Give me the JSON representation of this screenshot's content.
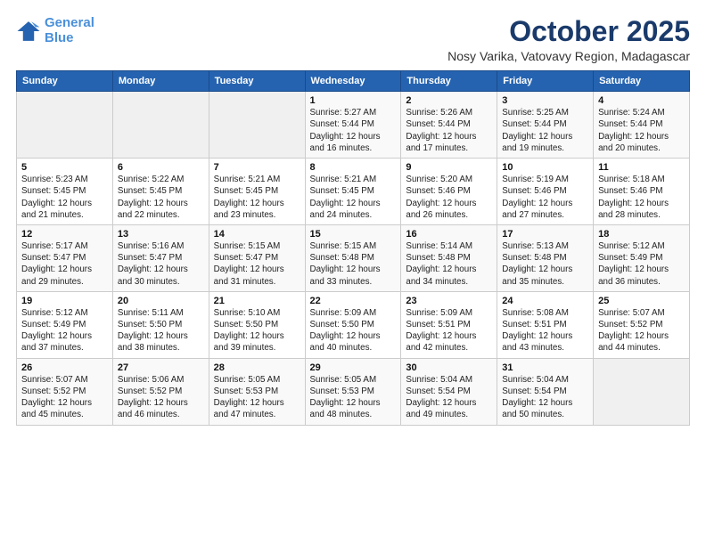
{
  "logo": {
    "line1": "General",
    "line2": "Blue"
  },
  "title": "October 2025",
  "location": "Nosy Varika, Vatovavy Region, Madagascar",
  "headers": [
    "Sunday",
    "Monday",
    "Tuesday",
    "Wednesday",
    "Thursday",
    "Friday",
    "Saturday"
  ],
  "weeks": [
    [
      {
        "day": "",
        "info": ""
      },
      {
        "day": "",
        "info": ""
      },
      {
        "day": "",
        "info": ""
      },
      {
        "day": "1",
        "info": "Sunrise: 5:27 AM\nSunset: 5:44 PM\nDaylight: 12 hours and 16 minutes."
      },
      {
        "day": "2",
        "info": "Sunrise: 5:26 AM\nSunset: 5:44 PM\nDaylight: 12 hours and 17 minutes."
      },
      {
        "day": "3",
        "info": "Sunrise: 5:25 AM\nSunset: 5:44 PM\nDaylight: 12 hours and 19 minutes."
      },
      {
        "day": "4",
        "info": "Sunrise: 5:24 AM\nSunset: 5:44 PM\nDaylight: 12 hours and 20 minutes."
      }
    ],
    [
      {
        "day": "5",
        "info": "Sunrise: 5:23 AM\nSunset: 5:45 PM\nDaylight: 12 hours and 21 minutes."
      },
      {
        "day": "6",
        "info": "Sunrise: 5:22 AM\nSunset: 5:45 PM\nDaylight: 12 hours and 22 minutes."
      },
      {
        "day": "7",
        "info": "Sunrise: 5:21 AM\nSunset: 5:45 PM\nDaylight: 12 hours and 23 minutes."
      },
      {
        "day": "8",
        "info": "Sunrise: 5:21 AM\nSunset: 5:45 PM\nDaylight: 12 hours and 24 minutes."
      },
      {
        "day": "9",
        "info": "Sunrise: 5:20 AM\nSunset: 5:46 PM\nDaylight: 12 hours and 26 minutes."
      },
      {
        "day": "10",
        "info": "Sunrise: 5:19 AM\nSunset: 5:46 PM\nDaylight: 12 hours and 27 minutes."
      },
      {
        "day": "11",
        "info": "Sunrise: 5:18 AM\nSunset: 5:46 PM\nDaylight: 12 hours and 28 minutes."
      }
    ],
    [
      {
        "day": "12",
        "info": "Sunrise: 5:17 AM\nSunset: 5:47 PM\nDaylight: 12 hours and 29 minutes."
      },
      {
        "day": "13",
        "info": "Sunrise: 5:16 AM\nSunset: 5:47 PM\nDaylight: 12 hours and 30 minutes."
      },
      {
        "day": "14",
        "info": "Sunrise: 5:15 AM\nSunset: 5:47 PM\nDaylight: 12 hours and 31 minutes."
      },
      {
        "day": "15",
        "info": "Sunrise: 5:15 AM\nSunset: 5:48 PM\nDaylight: 12 hours and 33 minutes."
      },
      {
        "day": "16",
        "info": "Sunrise: 5:14 AM\nSunset: 5:48 PM\nDaylight: 12 hours and 34 minutes."
      },
      {
        "day": "17",
        "info": "Sunrise: 5:13 AM\nSunset: 5:48 PM\nDaylight: 12 hours and 35 minutes."
      },
      {
        "day": "18",
        "info": "Sunrise: 5:12 AM\nSunset: 5:49 PM\nDaylight: 12 hours and 36 minutes."
      }
    ],
    [
      {
        "day": "19",
        "info": "Sunrise: 5:12 AM\nSunset: 5:49 PM\nDaylight: 12 hours and 37 minutes."
      },
      {
        "day": "20",
        "info": "Sunrise: 5:11 AM\nSunset: 5:50 PM\nDaylight: 12 hours and 38 minutes."
      },
      {
        "day": "21",
        "info": "Sunrise: 5:10 AM\nSunset: 5:50 PM\nDaylight: 12 hours and 39 minutes."
      },
      {
        "day": "22",
        "info": "Sunrise: 5:09 AM\nSunset: 5:50 PM\nDaylight: 12 hours and 40 minutes."
      },
      {
        "day": "23",
        "info": "Sunrise: 5:09 AM\nSunset: 5:51 PM\nDaylight: 12 hours and 42 minutes."
      },
      {
        "day": "24",
        "info": "Sunrise: 5:08 AM\nSunset: 5:51 PM\nDaylight: 12 hours and 43 minutes."
      },
      {
        "day": "25",
        "info": "Sunrise: 5:07 AM\nSunset: 5:52 PM\nDaylight: 12 hours and 44 minutes."
      }
    ],
    [
      {
        "day": "26",
        "info": "Sunrise: 5:07 AM\nSunset: 5:52 PM\nDaylight: 12 hours and 45 minutes."
      },
      {
        "day": "27",
        "info": "Sunrise: 5:06 AM\nSunset: 5:52 PM\nDaylight: 12 hours and 46 minutes."
      },
      {
        "day": "28",
        "info": "Sunrise: 5:05 AM\nSunset: 5:53 PM\nDaylight: 12 hours and 47 minutes."
      },
      {
        "day": "29",
        "info": "Sunrise: 5:05 AM\nSunset: 5:53 PM\nDaylight: 12 hours and 48 minutes."
      },
      {
        "day": "30",
        "info": "Sunrise: 5:04 AM\nSunset: 5:54 PM\nDaylight: 12 hours and 49 minutes."
      },
      {
        "day": "31",
        "info": "Sunrise: 5:04 AM\nSunset: 5:54 PM\nDaylight: 12 hours and 50 minutes."
      },
      {
        "day": "",
        "info": ""
      }
    ]
  ]
}
